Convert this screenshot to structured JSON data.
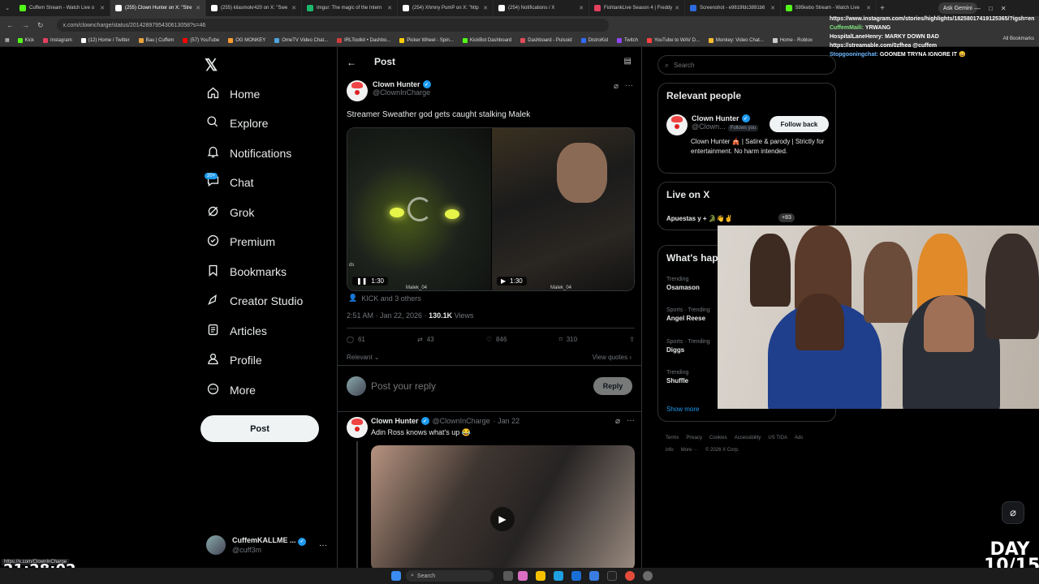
{
  "browser": {
    "tabs": [
      {
        "label": "Cuffem Stream - Watch Live o",
        "color": "#53fc18"
      },
      {
        "label": "(255) Clown Hunter on X: \"Stre",
        "color": "#ffffff",
        "active": true
      },
      {
        "label": "(255) kilasmokr420 on X: \"Swe",
        "color": "#ffffff"
      },
      {
        "label": "Imgur: The magic of the Intern",
        "color": "#1bb76e"
      },
      {
        "label": "(254) Xhmny PumP on X: \"http",
        "color": "#ffffff"
      },
      {
        "label": "(254) Notifications / X",
        "color": "#ffffff"
      },
      {
        "label": "FishtankLive Season 4 | Freddy",
        "color": "#e4405f"
      },
      {
        "label": "Screenshot - e9819fdc3891b6",
        "color": "#2d6cdf"
      },
      {
        "label": "595kebo Stream - Watch Live",
        "color": "#53fc18"
      }
    ],
    "new_tab": "+",
    "ask_gemini": "Ask Gemini",
    "url": "x.com/clowncharge/status/2014289795430613058?s=46",
    "bookmarks": [
      {
        "label": "Kick",
        "color": "#53fc18"
      },
      {
        "label": "Instagram",
        "color": "#e4405f"
      },
      {
        "label": "(12) Home / Twitter",
        "color": "#ffffff"
      },
      {
        "label": "Bau | Cuffem",
        "color": "#e8a33d"
      },
      {
        "label": "(57) YouTube",
        "color": "#ff0000"
      },
      {
        "label": "OG MONKEY",
        "color": "#ff9d2e"
      },
      {
        "label": "OmeTV Video Chat...",
        "color": "#4fa3e0"
      },
      {
        "label": "IRLToolkit • Dashbo...",
        "color": "#d23c3c"
      },
      {
        "label": "Picker Wheel - Spin...",
        "color": "#ffcc00"
      },
      {
        "label": "KickBot Dashboard",
        "color": "#53fc18"
      },
      {
        "label": "Dashboard - Pulsoid",
        "color": "#e14c5a"
      },
      {
        "label": "DistroKid",
        "color": "#2f6bff"
      },
      {
        "label": "Twitch",
        "color": "#9146ff"
      },
      {
        "label": "YouTube to WAV D...",
        "color": "#ff4040"
      },
      {
        "label": "Monkey: Video Chat...",
        "color": "#ffbd2e"
      },
      {
        "label": "Home - Roblox",
        "color": "#cccccc"
      }
    ],
    "all_bookmarks": "All Bookmarks",
    "status_url": "https://x.com/ClownInCharge"
  },
  "nav": {
    "items": [
      {
        "label": "Home",
        "icon": "home-icon"
      },
      {
        "label": "Explore",
        "icon": "search-icon"
      },
      {
        "label": "Notifications",
        "icon": "bell-icon"
      },
      {
        "label": "Chat",
        "icon": "chat-icon"
      },
      {
        "label": "Grok",
        "icon": "grok-icon"
      },
      {
        "label": "Premium",
        "icon": "premium-icon"
      },
      {
        "label": "Bookmarks",
        "icon": "bookmark-icon"
      },
      {
        "label": "Creator Studio",
        "icon": "rocket-icon"
      },
      {
        "label": "Articles",
        "icon": "article-icon"
      },
      {
        "label": "Profile",
        "icon": "person-icon"
      },
      {
        "label": "More",
        "icon": "more-circle-icon"
      }
    ],
    "chat_badge": "20+",
    "post_button": "Post",
    "account": {
      "name": "CuffemKALLME ...",
      "handle": "@cuff3m"
    }
  },
  "post": {
    "header_title": "Post",
    "author_name": "Clown Hunter",
    "author_handle": "@ClownInCharge",
    "text": "Streamer Sweather god gets caught stalking Malek",
    "video1_duration": "1:30",
    "video2_duration": "1:30",
    "watermark": "Malek_04",
    "video_label_left": "ds",
    "liked_by": "KICK and 3 others",
    "time": "2:51 AM · Jan 22, 2026 · ",
    "views_count": "130.1K",
    "views_label": " Views",
    "stats": {
      "replies": "61",
      "reposts": "43",
      "likes": "846",
      "bookmarks": "310"
    },
    "sort_label": "Relevant",
    "view_quotes": "View quotes",
    "reply_placeholder": "Post your reply",
    "reply_button": "Reply"
  },
  "reply": {
    "author_name": "Clown Hunter",
    "author_handle": "@ClownInCharge",
    "date": "· Jan 22",
    "text": "Adin Ross knows what's up 😂"
  },
  "sidebar": {
    "search_placeholder": "Search",
    "relevant_title": "Relevant people",
    "person_name": "Clown Hunter",
    "person_handle": "@Clown...",
    "follows_you": "Follows you",
    "follow_back": "Follow back",
    "person_bio": "Clown Hunter 🎪 | Satire & parody | Strictly for entertainment. No harm intended.",
    "live_title": "Live on X",
    "live_item": "Apuestas y + 🐊👋✌",
    "live_count": "+83",
    "happening_title": "What's hap",
    "trends": [
      {
        "context": "Trending",
        "name": "Osamason"
      },
      {
        "context": "Sports · Trending",
        "name": "Angel Reese"
      },
      {
        "context": "Sports · Trending",
        "name": "Diggs"
      },
      {
        "context": "Trending",
        "name": "Shuffle"
      }
    ],
    "show_more": "Show more",
    "footer": [
      "Terms",
      "Privacy",
      "Cookies",
      "Accessibility",
      "US TIDA",
      "Ads info",
      "More ···",
      "© 2026 X Corp."
    ]
  },
  "overlay": {
    "chat_lines": [
      {
        "user": "",
        "text": "https://www.instagram.com/stories/highlights/18258017419125365/?igsh=en"
      },
      {
        "user": "CuffemMaili:",
        "text": "YRWANG"
      },
      {
        "user": "",
        "text": "HospitalLaneHenry: MARKY DOWN BAD"
      },
      {
        "user": "",
        "text": "https://streamable.com/0zfhea @cuffem"
      },
      {
        "user": "Stopgooningchat:",
        "text": "GOONEM TRYNA IGNORE IT 😄"
      }
    ],
    "clock": "21:28:02",
    "day_line1": "DAY",
    "day_line2": "10/15"
  },
  "taskbar": {
    "search": "Search"
  }
}
